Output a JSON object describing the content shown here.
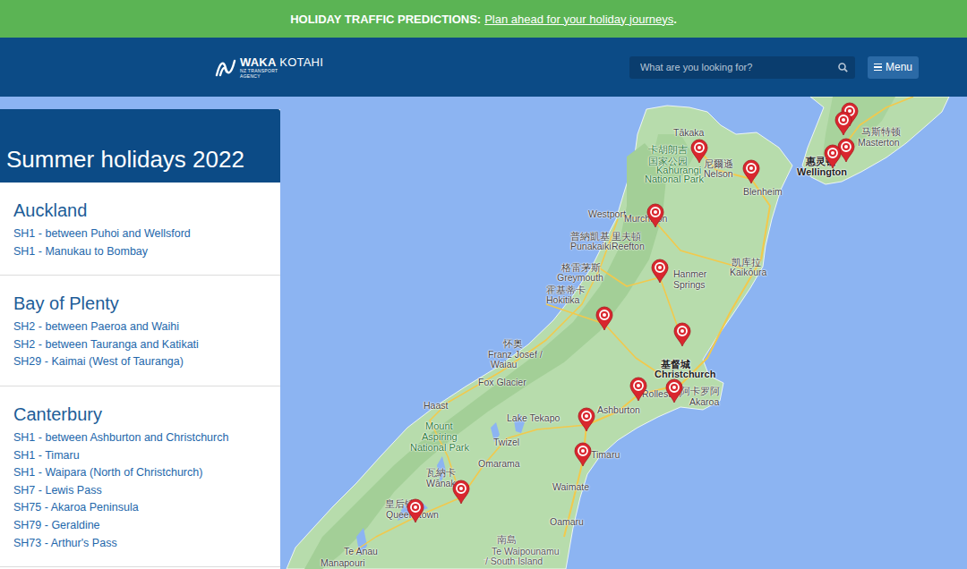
{
  "banner": {
    "label": "HOLIDAY TRAFFIC PREDICTIONS:",
    "link": "Plan ahead for your holiday journeys",
    "suffix": "."
  },
  "header": {
    "logo_bold": "WAKA",
    "logo_light": "KOTAHI",
    "logo_sub_1": "NZ TRANSPORT",
    "logo_sub_2": "AGENCY",
    "search_placeholder": "What are you looking for?",
    "menu": "Menu"
  },
  "panel": {
    "title": "Summer holidays 2022",
    "regions": [
      {
        "name": "Auckland",
        "links": [
          "SH1 - between Puhoi and Wellsford",
          "SH1 - Manukau to Bombay"
        ]
      },
      {
        "name": "Bay of Plenty",
        "links": [
          "SH2 - between Paeroa and Waihi",
          "SH2 - between Tauranga and Katikati",
          "SH29 - Kaimai (West of Tauranga)"
        ]
      },
      {
        "name": "Canterbury",
        "links": [
          "SH1 - between Ashburton and Christchurch",
          "SH1 - Timaru",
          "SH1 - Waipara (North of Christchurch)",
          "SH7 - Lewis Pass",
          "SH75 - Akaroa Peninsula",
          "SH79 - Geraldine",
          "SH73 - Arthur's Pass"
        ]
      }
    ]
  },
  "map": {
    "labels": [
      {
        "text": "Tākaka",
        "kind": "place"
      },
      {
        "text": "卡胡朗吉",
        "kind": "park"
      },
      {
        "text": "国家公园",
        "kind": "park"
      },
      {
        "text": "Kahurangi",
        "kind": "park"
      },
      {
        "text": "National Park",
        "kind": "park"
      },
      {
        "text": "尼爾遜",
        "kind": "place"
      },
      {
        "text": "Nelson",
        "kind": "place"
      },
      {
        "text": "Blenheim",
        "kind": "place"
      },
      {
        "text": "Westport",
        "kind": "place"
      },
      {
        "text": "Murchison",
        "kind": "place"
      },
      {
        "text": "普納凱基",
        "kind": "place"
      },
      {
        "text": "里夫頓",
        "kind": "place"
      },
      {
        "text": "Punakaiki",
        "kind": "place"
      },
      {
        "text": "Reefton",
        "kind": "place"
      },
      {
        "text": "格雷茅斯",
        "kind": "place"
      },
      {
        "text": "Greymouth",
        "kind": "place"
      },
      {
        "text": "霍基蒂卡",
        "kind": "place"
      },
      {
        "text": "Hokitika",
        "kind": "place"
      },
      {
        "text": "Hanmer",
        "kind": "place"
      },
      {
        "text": "Springs",
        "kind": "place"
      },
      {
        "text": "凯库拉",
        "kind": "place"
      },
      {
        "text": "Kaikōura",
        "kind": "place"
      },
      {
        "text": "怀奥",
        "kind": "place"
      },
      {
        "text": "Franz Josef /",
        "kind": "place"
      },
      {
        "text": "Waiau",
        "kind": "place"
      },
      {
        "text": "Fox Glacier",
        "kind": "place"
      },
      {
        "text": "基督城",
        "kind": "city"
      },
      {
        "text": "Christchurch",
        "kind": "city"
      },
      {
        "text": "Rolleston",
        "kind": "place"
      },
      {
        "text": "阿卡罗阿",
        "kind": "place"
      },
      {
        "text": "Akaroa",
        "kind": "place"
      },
      {
        "text": "Ashburton",
        "kind": "place"
      },
      {
        "text": "Haast",
        "kind": "place"
      },
      {
        "text": "Mount",
        "kind": "park"
      },
      {
        "text": "Aspiring",
        "kind": "park"
      },
      {
        "text": "National Park",
        "kind": "park"
      },
      {
        "text": "Lake Tekapo",
        "kind": "place"
      },
      {
        "text": "Twizel",
        "kind": "place"
      },
      {
        "text": "Omarama",
        "kind": "place"
      },
      {
        "text": "Timaru",
        "kind": "place"
      },
      {
        "text": "Waimate",
        "kind": "place"
      },
      {
        "text": "瓦納卡",
        "kind": "place"
      },
      {
        "text": "Wānaka",
        "kind": "place"
      },
      {
        "text": "皇后镇",
        "kind": "place"
      },
      {
        "text": "Queenstown",
        "kind": "place"
      },
      {
        "text": "南島",
        "kind": "region"
      },
      {
        "text": "Te Waipounamu",
        "kind": "region"
      },
      {
        "text": "/ South Island",
        "kind": "region"
      },
      {
        "text": "Oamaru",
        "kind": "place"
      },
      {
        "text": "Te Anau",
        "kind": "place"
      },
      {
        "text": "Manapouri",
        "kind": "place"
      },
      {
        "text": "马斯特顿",
        "kind": "place"
      },
      {
        "text": "Masterton",
        "kind": "place"
      },
      {
        "text": "惠灵顿",
        "kind": "city"
      },
      {
        "text": "Wellington",
        "kind": "city"
      }
    ]
  }
}
